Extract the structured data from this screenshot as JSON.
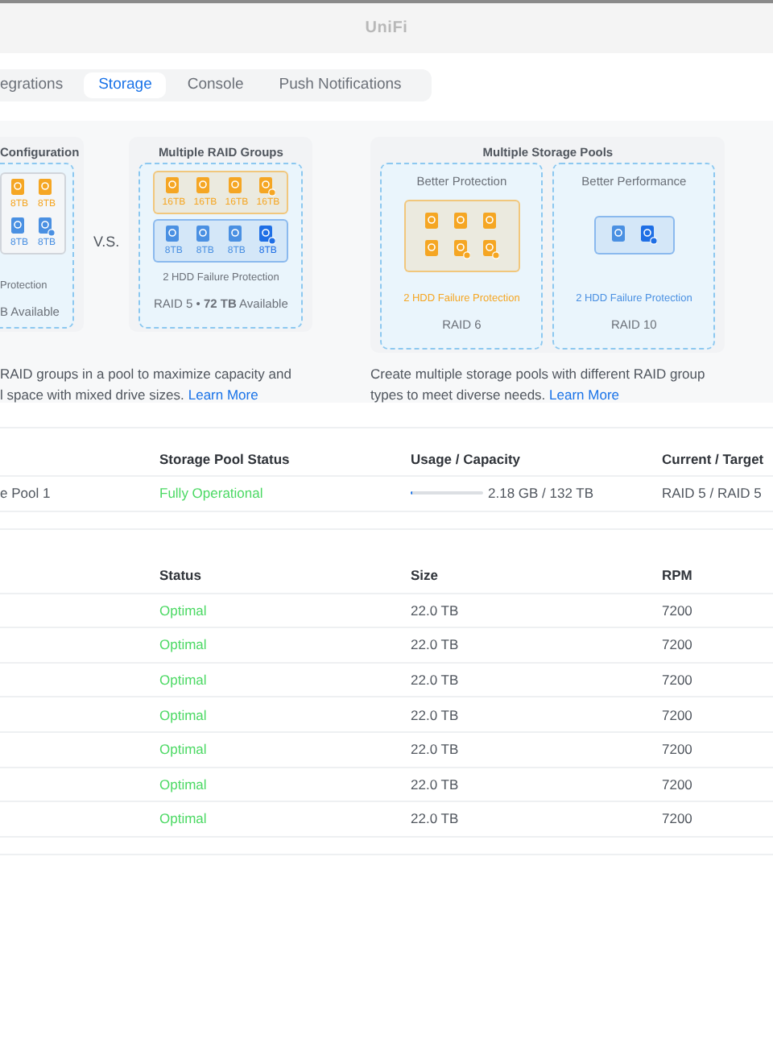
{
  "window": {
    "title": "UniFi"
  },
  "tabs": [
    {
      "label": "egrations",
      "selected": false
    },
    {
      "label": "Storage",
      "selected": true
    },
    {
      "label": "Console",
      "selected": false
    },
    {
      "label": "Push Notifications",
      "selected": false
    }
  ],
  "comparison": {
    "left": {
      "title": "Configuration",
      "groups": [
        {
          "color": "#d1d5db",
          "drives": [
            {
              "label": "8TB",
              "color": "#f5a623",
              "parity": false
            },
            {
              "label": "8TB",
              "color": "#f5a623",
              "parity": false
            },
            {
              "label": "8TB",
              "color": "#4a90e2",
              "parity": false
            },
            {
              "label": "8TB",
              "color": "#4a90e2",
              "parity": true
            }
          ]
        }
      ],
      "protection": "Protection",
      "summary": "B Available"
    },
    "separator": "V.S.",
    "middle": {
      "title": "Multiple RAID Groups",
      "groups": [
        {
          "color": "#f5a623",
          "drives": [
            {
              "label": "16TB",
              "color": "#f5a623",
              "parity": false
            },
            {
              "label": "16TB",
              "color": "#f5a623",
              "parity": false
            },
            {
              "label": "16TB",
              "color": "#f5a623",
              "parity": false
            },
            {
              "label": "16TB",
              "color": "#f5a623",
              "parity": true
            }
          ]
        },
        {
          "color": "#4a90e2",
          "drives": [
            {
              "label": "8TB",
              "color": "#4a90e2",
              "parity": false
            },
            {
              "label": "8TB",
              "color": "#4a90e2",
              "parity": false
            },
            {
              "label": "8TB",
              "color": "#4a90e2",
              "parity": false
            },
            {
              "label": "8TB",
              "color": "#1f6fe5",
              "parity": true
            }
          ]
        }
      ],
      "protection": "2 HDD Failure Protection",
      "summary": "RAID 5 • **72 TB** Available"
    },
    "left_description": {
      "lines": [
        "RAID groups in a pool to maximize capacity and",
        "l space with mixed drive sizes."
      ],
      "link": "Learn More"
    },
    "right": {
      "title": "Multiple Storage Pools",
      "panes": [
        {
          "title": "Better Protection",
          "color": "#f5a623",
          "drives": [
            {
              "color": "#f5a623",
              "parity": false
            },
            {
              "color": "#f5a623",
              "parity": false
            },
            {
              "color": "#f5a623",
              "parity": false
            },
            {
              "color": "#f5a623",
              "parity": false
            },
            {
              "color": "#f5a623",
              "parity": true
            },
            {
              "color": "#f5a623",
              "parity": true
            }
          ],
          "protection": "2 HDD Failure Protection",
          "raid": "RAID 6"
        },
        {
          "title": "Better Performance",
          "color": "#4a90e2",
          "drives": [
            {
              "color": "#4a90e2",
              "parity": false
            },
            {
              "color": "#1f6fe5",
              "parity": true
            }
          ],
          "protection": "2 HDD Failure Protection",
          "raid": "RAID 10"
        }
      ]
    },
    "right_description": {
      "text": "Create multiple storage pools with different RAID group types to meet diverse needs.",
      "link": "Learn More"
    }
  },
  "pool_table": {
    "columns": [
      "Storage Pool Status",
      "Usage / Capacity",
      "Current / Target"
    ],
    "rows": [
      {
        "name": "e Pool 1",
        "status": "Fully Operational",
        "level": 0.01,
        "usage": "2.18 GB / 132 TB",
        "raid": "RAID 5 / RAID 5"
      }
    ]
  },
  "disk_table": {
    "columns": [
      "Status",
      "Size",
      "RPM"
    ],
    "rows": [
      {
        "status": "Optimal",
        "size": "22.0 TB",
        "rpm": "7200"
      },
      {
        "status": "Optimal",
        "size": "22.0 TB",
        "rpm": "7200"
      },
      {
        "status": "Optimal",
        "size": "22.0 TB",
        "rpm": "7200"
      },
      {
        "status": "Optimal",
        "size": "22.0 TB",
        "rpm": "7200"
      },
      {
        "status": "Optimal",
        "size": "22.0 TB",
        "rpm": "7200"
      },
      {
        "status": "Optimal",
        "size": "22.0 TB",
        "rpm": "7200"
      },
      {
        "status": "Optimal",
        "size": "22.0 TB",
        "rpm": "7200"
      }
    ]
  }
}
